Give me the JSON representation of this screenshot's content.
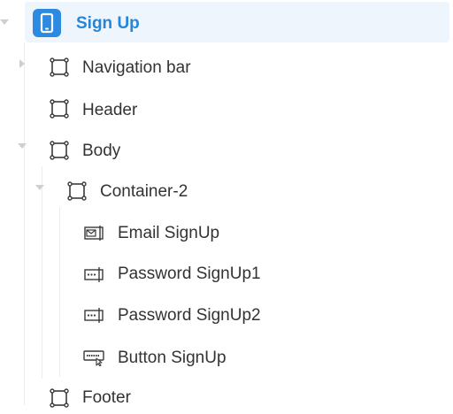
{
  "tree": {
    "root": {
      "label": "Sign Up",
      "icon": "mobile-page-icon",
      "expanded": true,
      "selected": true
    },
    "items": [
      {
        "key": "navigation-bar",
        "label": "Navigation bar",
        "icon": "container-frame-icon",
        "expanded": false
      },
      {
        "key": "header",
        "label": "Header",
        "icon": "container-frame-icon"
      },
      {
        "key": "body",
        "label": "Body",
        "icon": "container-frame-icon",
        "expanded": true
      },
      {
        "key": "container-2",
        "label": "Container-2",
        "icon": "container-frame-icon",
        "expanded": true
      },
      {
        "key": "email-signup",
        "label": "Email SignUp",
        "icon": "email-input-icon"
      },
      {
        "key": "password-signup1",
        "label": "Password SignUp1",
        "icon": "password-input-icon"
      },
      {
        "key": "password-signup2",
        "label": "Password SignUp2",
        "icon": "password-input-icon"
      },
      {
        "key": "button-signup",
        "label": "Button SignUp",
        "icon": "button-widget-icon"
      },
      {
        "key": "footer",
        "label": "Footer",
        "icon": "container-frame-icon"
      }
    ]
  },
  "colors": {
    "accent": "#2c8be0",
    "accent_text": "#2585d6",
    "selected_bg": "#eef5fc",
    "text": "#333333",
    "guide": "#ececec"
  }
}
